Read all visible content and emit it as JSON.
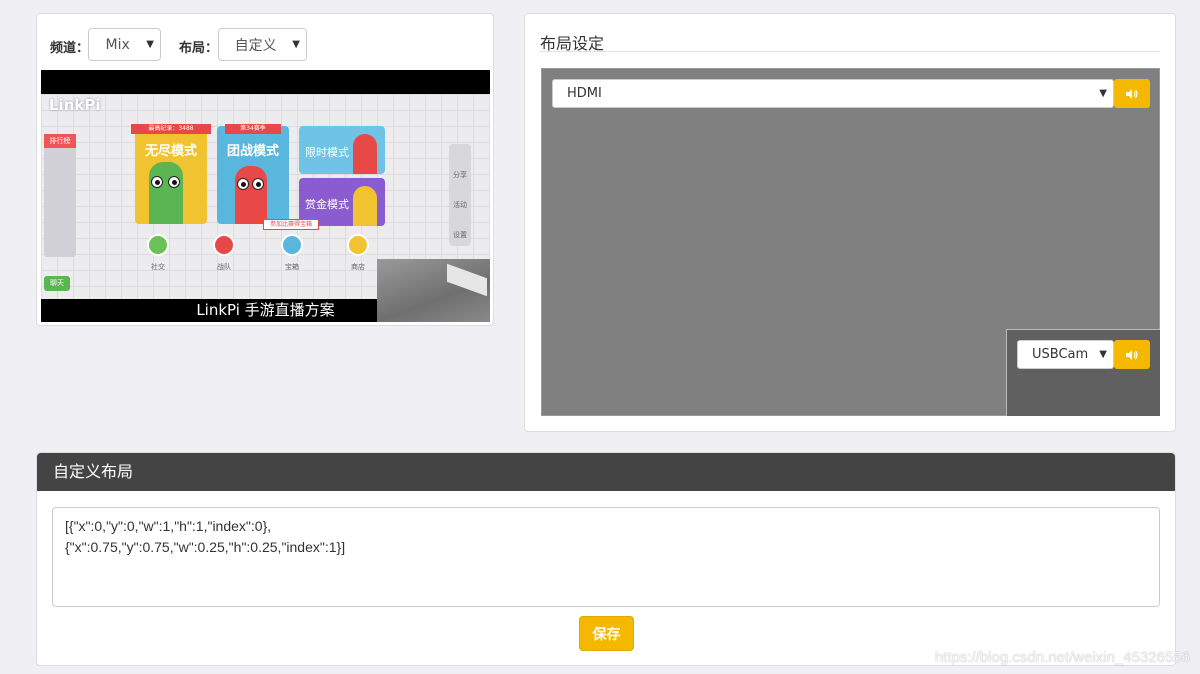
{
  "preview": {
    "channel_label": "频道：",
    "channel_value": "Mix",
    "layout_label": "布局：",
    "layout_value": "自定义",
    "game": {
      "logo_text": "LinkPi",
      "record_label": "最高纪录：3488",
      "season_label": "第34赛季",
      "modes": [
        "无尽模式",
        "团战模式",
        "限时模式",
        "赏金模式"
      ],
      "leaderboard": "排行榜",
      "bottom_icons": [
        "社交",
        "战队",
        "宝箱",
        "商店"
      ],
      "side_icons": [
        "分享",
        "活动",
        "设置"
      ],
      "chat": "聊天",
      "reward_banner": "参加比赛得宝箱",
      "caption": "LinkPi 手游直播方案"
    }
  },
  "layout_settings": {
    "title": "布局设定",
    "main_source": "HDMI",
    "sub_source": "USBCam",
    "colors": {
      "accent": "#f5b800"
    }
  },
  "custom_layout": {
    "title": "自定义布局",
    "json_value": "[{\"x\":0,\"y\":0,\"w\":1,\"h\":1,\"index\":0},\n{\"x\":0.75,\"y\":0.75,\"w\":0.25,\"h\":0.25,\"index\":1}]",
    "save_label": "保存"
  },
  "watermark": "https://blog.csdn.net/weixin_45326556"
}
